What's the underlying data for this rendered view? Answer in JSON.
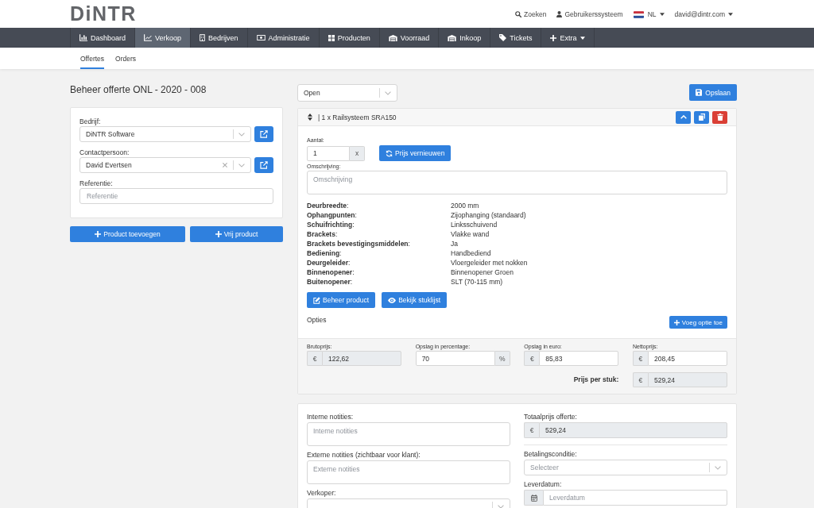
{
  "header": {
    "logo": "DiNTR",
    "links": [
      {
        "kind": "search",
        "label": "Zoeken",
        "dropdown": false
      },
      {
        "kind": "user",
        "label": "Gebruikerssysteem",
        "dropdown": false
      },
      {
        "kind": "language",
        "label": "NL",
        "dropdown": true
      },
      {
        "kind": "account",
        "label": "david@dintr.com",
        "dropdown": true
      }
    ]
  },
  "nav": [
    {
      "label": "Dashboard",
      "selected": false,
      "dropdown": false
    },
    {
      "label": "Verkoop",
      "selected": true,
      "dropdown": false
    },
    {
      "label": "Bedrijven",
      "selected": false,
      "dropdown": false
    },
    {
      "label": "Administratie",
      "selected": false,
      "dropdown": false
    },
    {
      "label": "Producten",
      "selected": false,
      "dropdown": false
    },
    {
      "label": "Voorraad",
      "selected": false,
      "dropdown": false
    },
    {
      "label": "Inkoop",
      "selected": false,
      "dropdown": false
    },
    {
      "label": "Tickets",
      "selected": false,
      "dropdown": false
    },
    {
      "label": "Extra",
      "selected": false,
      "dropdown": true
    }
  ],
  "subnav": [
    {
      "label": "Offertes",
      "selected": true
    },
    {
      "label": "Orders",
      "selected": false
    }
  ],
  "quote": {
    "title": "Beheer offerte ONL - 2020 - 008",
    "fields": [
      {
        "kind": "select",
        "label": "Bedrijf:",
        "value": "DiNTR Software",
        "clearable": false,
        "link_button": true
      },
      {
        "kind": "select",
        "label": "Contactpersoon:",
        "value": "David Evertsen",
        "clearable": true,
        "link_button": true
      },
      {
        "kind": "input",
        "label": "Referentie:",
        "placeholder": "Referentie"
      }
    ],
    "buttons": [
      "Product toevoegen",
      "Vrij product"
    ]
  },
  "toolbar": {
    "status": "Open",
    "save_button": "Opslaan"
  },
  "product": {
    "title": "| 1 x Railsysteem SRA150",
    "quantity": {
      "label": "Aantal:",
      "value": "1",
      "addon": "x"
    },
    "refresh_button": "Prijs vernieuwen",
    "description": {
      "label": "Omschrijving:",
      "placeholder": "Omschrijving"
    },
    "specs": [
      {
        "name": "**Deurbreedte**:",
        "value": "2000 mm"
      },
      {
        "name": "**Ophangpunten**:",
        "value": "Zijophanging (standaard)"
      },
      {
        "name": "**Schuifrichting**:",
        "value": "Linksschuivend"
      },
      {
        "name": "**Brackets**:",
        "value": "Vlakke wand"
      },
      {
        "name": "**Brackets bevestigingsmiddelen**:",
        "value": "Ja"
      },
      {
        "name": "**Bediening**:",
        "value": "Handbediend"
      },
      {
        "name": "**Deurgeleider**:",
        "value": "Vloergeleider met nokken"
      },
      {
        "name": "**Binnenopener**:",
        "value": "Binnenopener Groen"
      },
      {
        "name": "**Buitenopener**:",
        "value": "SLT (70-115 mm)"
      }
    ],
    "buttons": [
      "Beheer product",
      "Bekijk stuklijst"
    ],
    "options": {
      "label": "Opties",
      "button": "Voeg optie toe"
    },
    "pricing": [
      {
        "label": "Brutoprijs:",
        "prefix": "€",
        "value": "122,62",
        "disabled": true
      },
      {
        "label": "Opslag in percentage:",
        "suffix": "%",
        "value": "70",
        "disabled": false
      },
      {
        "label": "Opslag in euro:",
        "prefix": "€",
        "value": "85,83",
        "disabled": false
      },
      {
        "label": "Nettoprijs:",
        "prefix": "€",
        "value": "208,45",
        "disabled": false
      }
    ],
    "unit_price": {
      "label": "Prijs per stuk:",
      "prefix": "€",
      "value": "529,24",
      "disabled": true
    }
  },
  "notes": {
    "left": [
      {
        "kind": "textarea",
        "label": "Interne notities:",
        "placeholder": "Interne notities"
      },
      {
        "kind": "textarea",
        "label": "Externe notities (zichtbaar voor klant):",
        "placeholder": "Externe notities"
      },
      {
        "kind": "select",
        "label": "Verkoper:",
        "clearable": false,
        "link_button": false
      }
    ],
    "right": [
      {
        "kind": "input",
        "label": "Totaalprijs offerte:",
        "prefix": "€",
        "value": "529,24",
        "disabled": true
      },
      {
        "kind": "select",
        "label": "Betalingsconditie:",
        "placeholder": "Selecteer",
        "clearable": false,
        "link_button": false
      },
      {
        "kind": "date",
        "label": "Leverdatum:",
        "placeholder": "Leverdatum"
      }
    ]
  }
}
